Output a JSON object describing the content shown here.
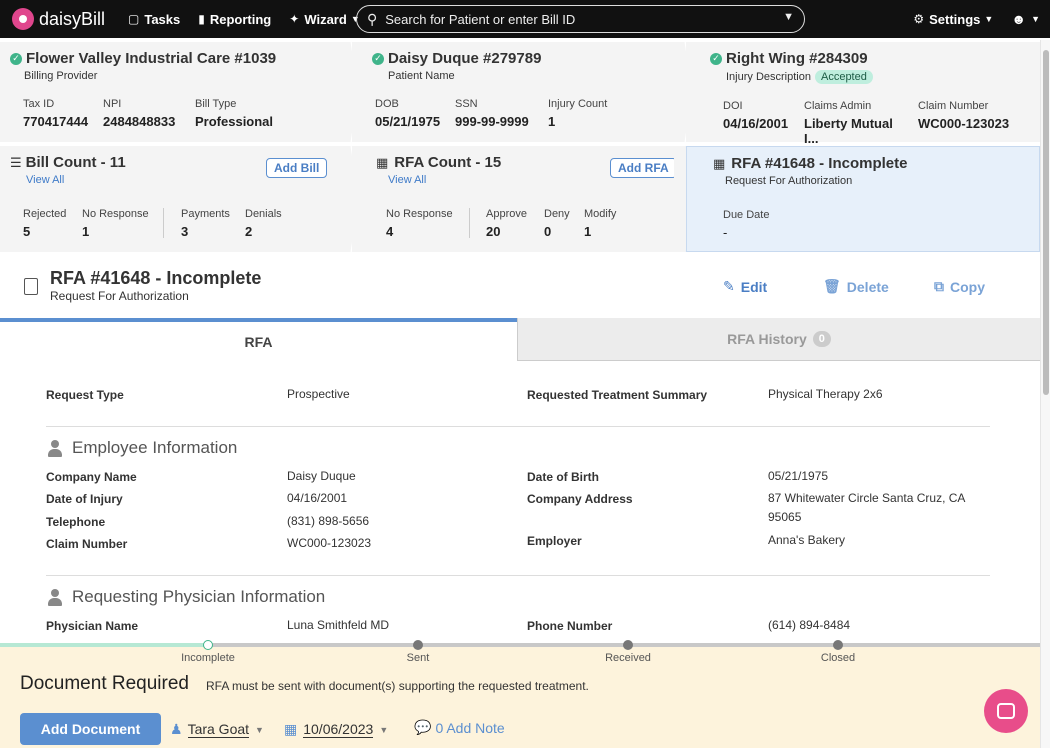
{
  "nav": {
    "logo": "daisyBill",
    "tasks": "Tasks",
    "reporting": "Reporting",
    "wizard": "Wizard",
    "search_placeholder": "Search for Patient or enter Bill ID",
    "settings": "Settings"
  },
  "provider": {
    "title": "Flower Valley Industrial Care #1039",
    "subtitle": "Billing Provider",
    "fields": [
      {
        "label": "Tax ID",
        "value": "770417444"
      },
      {
        "label": "NPI",
        "value": "2484848833"
      },
      {
        "label": "Bill Type",
        "value": "Professional"
      }
    ]
  },
  "patient": {
    "title": "Daisy Duque #279789",
    "subtitle": "Patient Name",
    "fields": [
      {
        "label": "DOB",
        "value": "05/21/1975"
      },
      {
        "label": "SSN",
        "value": "999-99-9999"
      },
      {
        "label": "Injury Count",
        "value": "1"
      }
    ]
  },
  "injury": {
    "title": "Right Wing #284309",
    "subtitle": "Injury Description",
    "status": "Accepted",
    "fields": [
      {
        "label": "DOI",
        "value": "04/16/2001"
      },
      {
        "label": "Claims Admin",
        "value": "Liberty Mutual I..."
      },
      {
        "label": "Claim Number",
        "value": "WC000-123023"
      }
    ]
  },
  "bills": {
    "title": "Bill Count - 11",
    "view_all": "View All",
    "add": "Add Bill",
    "fields": [
      {
        "label": "Rejected",
        "value": "5"
      },
      {
        "label": "No Response",
        "value": "1"
      },
      {
        "label": "Payments",
        "value": "3"
      },
      {
        "label": "Denials",
        "value": "2"
      }
    ]
  },
  "rfas": {
    "title": "RFA Count - 15",
    "view_all": "View All",
    "add": "Add RFA",
    "fields": [
      {
        "label": "No Response",
        "value": "4"
      },
      {
        "label": "Approve",
        "value": "20"
      },
      {
        "label": "Deny",
        "value": "0"
      },
      {
        "label": "Modify",
        "value": "1"
      }
    ]
  },
  "current_rfa": {
    "title": "RFA #41648 - Incomplete",
    "subtitle": "Request For Authorization",
    "due_label": "Due Date",
    "due_value": "-"
  },
  "rfa_header": {
    "title": "RFA #41648 - Incomplete",
    "subtitle": "Request For Authorization",
    "edit": "Edit",
    "delete": "Delete",
    "copy": "Copy"
  },
  "tabs": {
    "rfa": "RFA",
    "history": "RFA History",
    "history_count": "0"
  },
  "details": {
    "request_type_label": "Request Type",
    "request_type": "Prospective",
    "treatment_label": "Requested Treatment Summary",
    "treatment": "Physical Therapy 2x6",
    "employee_section": "Employee Information",
    "company_name_label": "Company Name",
    "company_name": "Daisy Duque",
    "dob_label": "Date of Birth",
    "dob": "05/21/1975",
    "doi_label": "Date of Injury",
    "doi": "04/16/2001",
    "company_address_label": "Company Address",
    "company_address_1": "87 Whitewater Circle Santa Cruz, CA",
    "company_address_2": "95065",
    "telephone_label": "Telephone",
    "telephone": "(831) 898-5656",
    "claim_number_label": "Claim Number",
    "claim_number": "WC000-123023",
    "employer_label": "Employer",
    "employer": "Anna's Bakery",
    "physician_section": "Requesting Physician Information",
    "physician_name_label": "Physician Name",
    "physician_name": "Luna Smithfeld MD",
    "phone_number_label": "Phone Number",
    "phone_number": "(614) 894-8484"
  },
  "progress": {
    "steps": [
      "Incomplete",
      "Sent",
      "Received",
      "Closed"
    ],
    "completed_fraction": 0.2
  },
  "footer": {
    "heading": "Document Required",
    "message": "RFA must be sent with document(s) supporting the requested treatment.",
    "add_document": "Add Document",
    "assignee": "Tara Goat",
    "date": "10/06/2023",
    "notes": "0 Add Note"
  },
  "colors": {
    "accent": "#5b8fd0",
    "success": "#3fb48a",
    "footer_bg": "#fdf3dc",
    "chat": "#e84d8a"
  }
}
